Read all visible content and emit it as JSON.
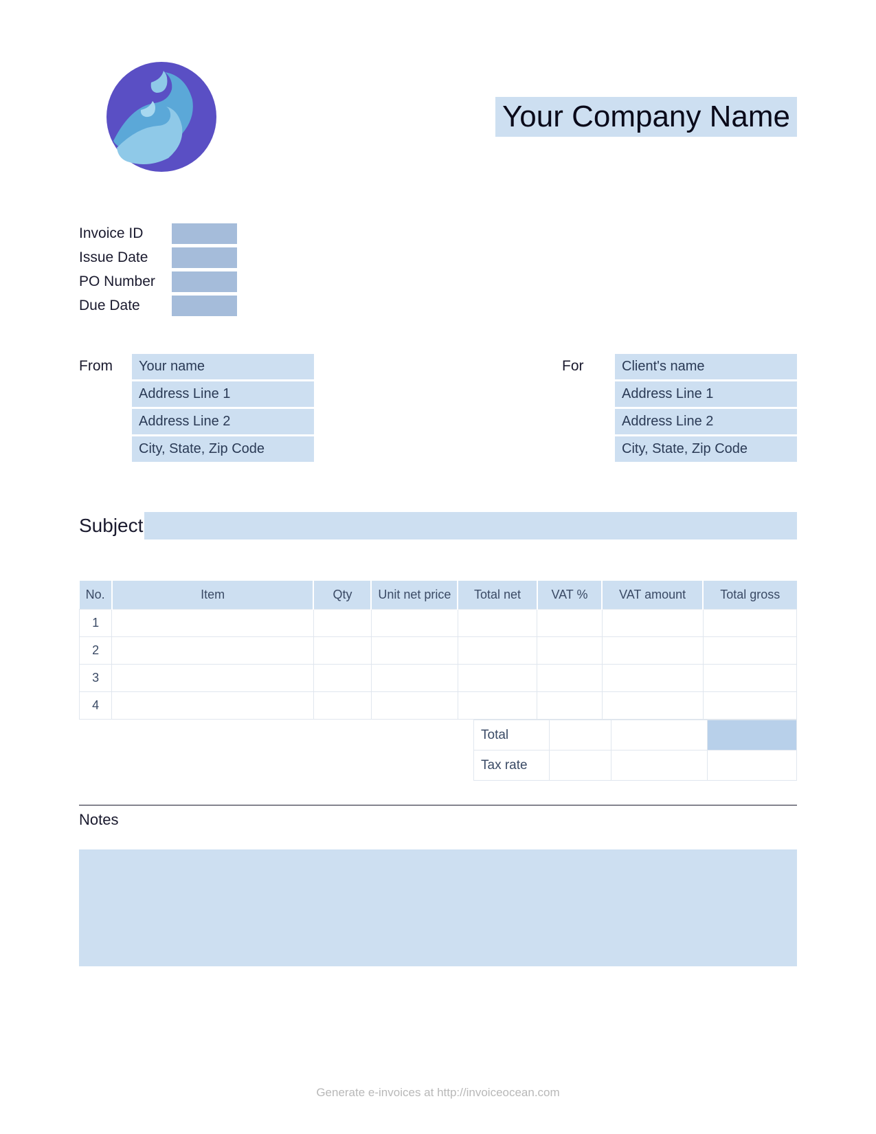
{
  "header": {
    "company_name": "Your Company Name"
  },
  "meta": {
    "invoice_id_label": "Invoice ID",
    "issue_date_label": "Issue Date",
    "po_number_label": "PO Number",
    "due_date_label": "Due Date",
    "invoice_id": "",
    "issue_date": "",
    "po_number": "",
    "due_date": ""
  },
  "from": {
    "label": "From",
    "name": "Your name",
    "address1": "Address Line 1",
    "address2": "Address Line 2",
    "city": "City, State, Zip Code"
  },
  "for": {
    "label": "For",
    "name": "Client's name",
    "address1": "Address Line 1",
    "address2": "Address Line 2",
    "city": "City, State, Zip Code"
  },
  "subject": {
    "label": "Subject",
    "value": ""
  },
  "table": {
    "headers": {
      "no": "No.",
      "item": "Item",
      "qty": "Qty",
      "unit_price": "Unit net price",
      "total_net": "Total net",
      "vat_pct": "VAT %",
      "vat_amount": "VAT amount",
      "total_gross": "Total gross"
    },
    "rows": [
      {
        "no": "1",
        "item": "",
        "qty": "",
        "unit_price": "",
        "total_net": "",
        "vat_pct": "",
        "vat_amount": "",
        "total_gross": ""
      },
      {
        "no": "2",
        "item": "",
        "qty": "",
        "unit_price": "",
        "total_net": "",
        "vat_pct": "",
        "vat_amount": "",
        "total_gross": ""
      },
      {
        "no": "3",
        "item": "",
        "qty": "",
        "unit_price": "",
        "total_net": "",
        "vat_pct": "",
        "vat_amount": "",
        "total_gross": ""
      },
      {
        "no": "4",
        "item": "",
        "qty": "",
        "unit_price": "",
        "total_net": "",
        "vat_pct": "",
        "vat_amount": "",
        "total_gross": ""
      }
    ]
  },
  "totals": {
    "total_label": "Total",
    "tax_rate_label": "Tax rate",
    "total_vat": "",
    "total_vat_amount": "",
    "total_gross": "",
    "tax_rate_vat": "",
    "tax_rate_amount": "",
    "tax_rate_gross": ""
  },
  "notes": {
    "label": "Notes",
    "value": ""
  },
  "footer": {
    "text": "Generate e-invoices at ",
    "link": "http://invoiceocean.com"
  }
}
